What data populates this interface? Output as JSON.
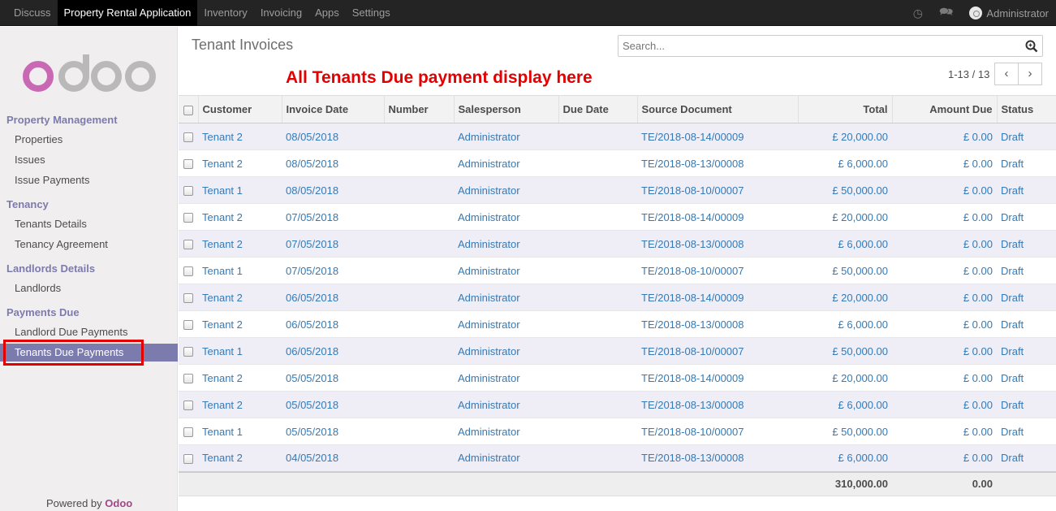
{
  "topbar": {
    "menu": [
      "Discuss",
      "Property Rental Application",
      "Inventory",
      "Invoicing",
      "Apps",
      "Settings"
    ],
    "active_index": 1,
    "user": "Administrator",
    "icons": [
      "clock-icon",
      "chat-icon",
      "avatar"
    ]
  },
  "sidebar": {
    "logo_text": "odoo",
    "sections": [
      {
        "title": "Property Management",
        "items": [
          "Properties",
          "Issues",
          "Issue Payments"
        ]
      },
      {
        "title": "Tenancy",
        "items": [
          "Tenants Details",
          "Tenancy Agreement"
        ]
      },
      {
        "title": "Landlords Details",
        "items": [
          "Landlords"
        ]
      },
      {
        "title": "Payments Due",
        "items": [
          "Landlord Due Payments",
          "Tenants Due Payments"
        ]
      }
    ],
    "active_item": "Tenants Due Payments",
    "powered_prefix": "Powered by",
    "powered_brand": "Odoo"
  },
  "control_panel": {
    "title": "Tenant Invoices",
    "annotation": "All Tenants Due payment display here",
    "search_placeholder": "Search...",
    "pager": "1-13 / 13",
    "prev": "‹",
    "next": "›"
  },
  "table": {
    "columns": [
      "Customer",
      "Invoice Date",
      "Number",
      "Salesperson",
      "Due Date",
      "Source Document",
      "Total",
      "Amount Due",
      "Status"
    ],
    "rows": [
      {
        "customer": "Tenant 2",
        "invoice_date": "08/05/2018",
        "number": "",
        "salesperson": "Administrator",
        "due_date": "",
        "source": "TE/2018-08-14/00009",
        "total": "£ 20,000.00",
        "amount_due": "£ 0.00",
        "status": "Draft"
      },
      {
        "customer": "Tenant 2",
        "invoice_date": "08/05/2018",
        "number": "",
        "salesperson": "Administrator",
        "due_date": "",
        "source": "TE/2018-08-13/00008",
        "total": "£ 6,000.00",
        "amount_due": "£ 0.00",
        "status": "Draft"
      },
      {
        "customer": "Tenant 1",
        "invoice_date": "08/05/2018",
        "number": "",
        "salesperson": "Administrator",
        "due_date": "",
        "source": "TE/2018-08-10/00007",
        "total": "£ 50,000.00",
        "amount_due": "£ 0.00",
        "status": "Draft"
      },
      {
        "customer": "Tenant 2",
        "invoice_date": "07/05/2018",
        "number": "",
        "salesperson": "Administrator",
        "due_date": "",
        "source": "TE/2018-08-14/00009",
        "total": "£ 20,000.00",
        "amount_due": "£ 0.00",
        "status": "Draft"
      },
      {
        "customer": "Tenant 2",
        "invoice_date": "07/05/2018",
        "number": "",
        "salesperson": "Administrator",
        "due_date": "",
        "source": "TE/2018-08-13/00008",
        "total": "£ 6,000.00",
        "amount_due": "£ 0.00",
        "status": "Draft"
      },
      {
        "customer": "Tenant 1",
        "invoice_date": "07/05/2018",
        "number": "",
        "salesperson": "Administrator",
        "due_date": "",
        "source": "TE/2018-08-10/00007",
        "total": "£ 50,000.00",
        "amount_due": "£ 0.00",
        "status": "Draft"
      },
      {
        "customer": "Tenant 2",
        "invoice_date": "06/05/2018",
        "number": "",
        "salesperson": "Administrator",
        "due_date": "",
        "source": "TE/2018-08-14/00009",
        "total": "£ 20,000.00",
        "amount_due": "£ 0.00",
        "status": "Draft"
      },
      {
        "customer": "Tenant 2",
        "invoice_date": "06/05/2018",
        "number": "",
        "salesperson": "Administrator",
        "due_date": "",
        "source": "TE/2018-08-13/00008",
        "total": "£ 6,000.00",
        "amount_due": "£ 0.00",
        "status": "Draft"
      },
      {
        "customer": "Tenant 1",
        "invoice_date": "06/05/2018",
        "number": "",
        "salesperson": "Administrator",
        "due_date": "",
        "source": "TE/2018-08-10/00007",
        "total": "£ 50,000.00",
        "amount_due": "£ 0.00",
        "status": "Draft"
      },
      {
        "customer": "Tenant 2",
        "invoice_date": "05/05/2018",
        "number": "",
        "salesperson": "Administrator",
        "due_date": "",
        "source": "TE/2018-08-14/00009",
        "total": "£ 20,000.00",
        "amount_due": "£ 0.00",
        "status": "Draft"
      },
      {
        "customer": "Tenant 2",
        "invoice_date": "05/05/2018",
        "number": "",
        "salesperson": "Administrator",
        "due_date": "",
        "source": "TE/2018-08-13/00008",
        "total": "£ 6,000.00",
        "amount_due": "£ 0.00",
        "status": "Draft"
      },
      {
        "customer": "Tenant 1",
        "invoice_date": "05/05/2018",
        "number": "",
        "salesperson": "Administrator",
        "due_date": "",
        "source": "TE/2018-08-10/00007",
        "total": "£ 50,000.00",
        "amount_due": "£ 0.00",
        "status": "Draft"
      },
      {
        "customer": "Tenant 2",
        "invoice_date": "04/05/2018",
        "number": "",
        "salesperson": "Administrator",
        "due_date": "",
        "source": "TE/2018-08-13/00008",
        "total": "£ 6,000.00",
        "amount_due": "£ 0.00",
        "status": "Draft"
      }
    ],
    "footer": {
      "total": "310,000.00",
      "amount_due": "0.00"
    }
  },
  "colors": {
    "accent": "#7c7bad",
    "link": "#337ab7",
    "annotation": "#e30000",
    "brand": "#a24689"
  }
}
